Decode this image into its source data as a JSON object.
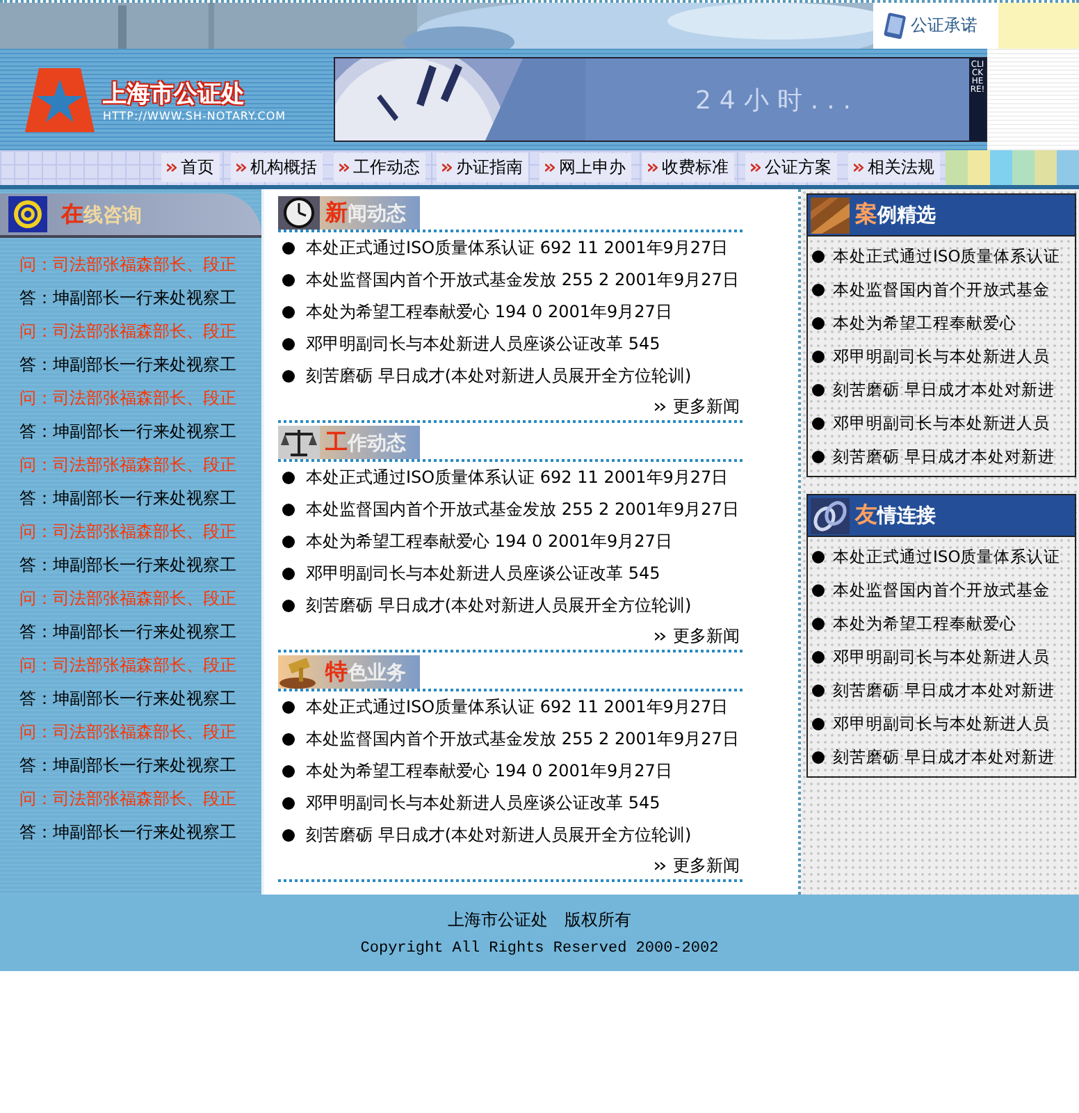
{
  "header": {
    "promise_link": "公证承诺",
    "logo": {
      "name": "上海市公证处",
      "url": "HTTP://WWW.SH-NOTARY.COM"
    },
    "banner": {
      "text": "24小时...",
      "side": "CLICK HERE!"
    }
  },
  "nav": [
    {
      "label": "首页"
    },
    {
      "label": "机构概括"
    },
    {
      "label": "工作动态"
    },
    {
      "label": "办证指南"
    },
    {
      "label": "网上申办"
    },
    {
      "label": "收费标准"
    },
    {
      "label": "公证方案"
    },
    {
      "label": "相关法规"
    }
  ],
  "consult": {
    "heading": {
      "accent": "在",
      "rest": "线咨询"
    },
    "items": [
      {
        "kind": "question",
        "text": "问：司法部张福森部长、段正"
      },
      {
        "kind": "answer",
        "text": "答：坤副部长一行来处视察工"
      },
      {
        "kind": "question",
        "text": "问：司法部张福森部长、段正"
      },
      {
        "kind": "answer",
        "text": "答：坤副部长一行来处视察工"
      },
      {
        "kind": "question",
        "text": "问：司法部张福森部长、段正"
      },
      {
        "kind": "answer",
        "text": "答：坤副部长一行来处视察工"
      },
      {
        "kind": "question",
        "text": "问：司法部张福森部长、段正"
      },
      {
        "kind": "answer",
        "text": "答：坤副部长一行来处视察工"
      },
      {
        "kind": "question",
        "text": "问：司法部张福森部长、段正"
      },
      {
        "kind": "answer",
        "text": "答：坤副部长一行来处视察工"
      },
      {
        "kind": "question",
        "text": "问：司法部张福森部长、段正"
      },
      {
        "kind": "answer",
        "text": "答：坤副部长一行来处视察工"
      },
      {
        "kind": "question",
        "text": "问：司法部张福森部长、段正"
      },
      {
        "kind": "answer",
        "text": "答：坤副部长一行来处视察工"
      },
      {
        "kind": "question",
        "text": "问：司法部张福森部长、段正"
      },
      {
        "kind": "answer",
        "text": "答：坤副部长一行来处视察工"
      },
      {
        "kind": "question",
        "text": "问：司法部张福森部长、段正"
      },
      {
        "kind": "answer",
        "text": "答：坤副部长一行来处视察工"
      }
    ]
  },
  "sections": [
    {
      "kind": "clock",
      "heading": {
        "accent": "新",
        "rest": "闻动态"
      },
      "items": [
        "本处正式通过ISO质量体系认证 692 11 2001年9月27日",
        "本处监督国内首个开放式基金发放 255 2 2001年9月27日",
        "本处为希望工程奉献爱心 194 0 2001年9月27日",
        "邓甲明副司长与本处新进人员座谈公证改革 545",
        "刻苦磨砺 早日成才(本处对新进人员展开全方位轮训)"
      ],
      "more": "更多新闻"
    },
    {
      "kind": "scales",
      "heading": {
        "accent": "工",
        "rest": "作动态"
      },
      "items": [
        "本处正式通过ISO质量体系认证 692 11 2001年9月27日",
        "本处监督国内首个开放式基金发放 255 2 2001年9月27日",
        "本处为希望工程奉献爱心 194 0 2001年9月27日",
        "邓甲明副司长与本处新进人员座谈公证改革 545",
        "刻苦磨砺 早日成才(本处对新进人员展开全方位轮训)"
      ],
      "more": "更多新闻"
    },
    {
      "kind": "gavel",
      "heading": {
        "accent": "特",
        "rest": "色业务"
      },
      "items": [
        "本处正式通过ISO质量体系认证 692 11 2001年9月27日",
        "本处监督国内首个开放式基金发放 255 2 2001年9月27日",
        "本处为希望工程奉献爱心 194 0 2001年9月27日",
        "邓甲明副司长与本处新进人员座谈公证改革 545",
        "刻苦磨砺 早日成才(本处对新进人员展开全方位轮训)"
      ],
      "more": "更多新闻"
    }
  ],
  "side_boxes": [
    {
      "kind": "cases",
      "heading": {
        "accent": "案",
        "rest": "例精选"
      },
      "items": [
        "本处正式通过ISO质量体系认证",
        "本处监督国内首个开放式基金",
        "本处为希望工程奉献爱心",
        "邓甲明副司长与本处新进人员",
        "刻苦磨砺 早日成才本处对新进",
        "邓甲明副司长与本处新进人员",
        "刻苦磨砺 早日成才本处对新进"
      ]
    },
    {
      "kind": "links",
      "heading": {
        "accent": "友",
        "rest": "情连接"
      },
      "items": [
        "本处正式通过ISO质量体系认证",
        "本处监督国内首个开放式基金",
        "本处为希望工程奉献爱心",
        "邓甲明副司长与本处新进人员",
        "刻苦磨砺 早日成才本处对新进",
        "邓甲明副司长与本处新进人员",
        "刻苦磨砺 早日成才本处对新进"
      ]
    }
  ],
  "footer": {
    "owner": "上海市公证处　版权所有",
    "copyright": "Copyright All Rights Reserved 2000-2002"
  }
}
